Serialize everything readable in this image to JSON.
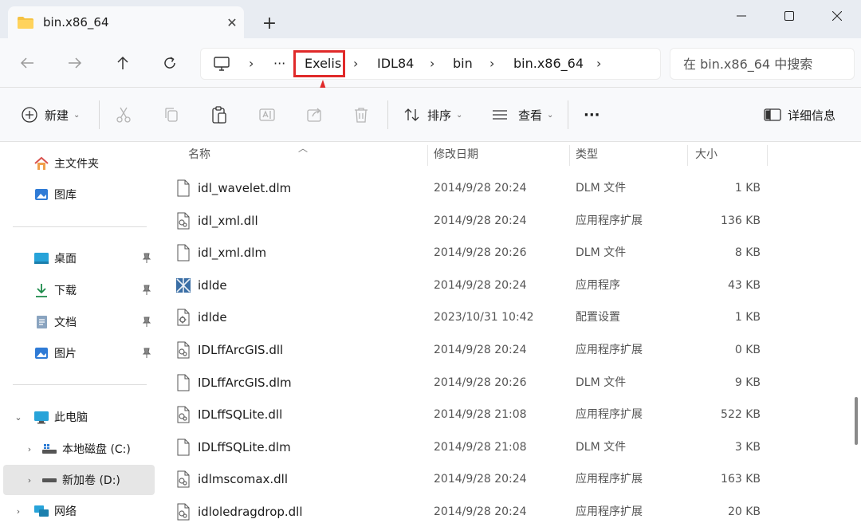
{
  "window": {
    "tab_title": "bin.x86_64",
    "new_tab": "+"
  },
  "breadcrumb": {
    "items": [
      "Exelis",
      "IDL84",
      "bin",
      "bin.x86_64"
    ],
    "overflow": "···",
    "separator": "›"
  },
  "search": {
    "placeholder": "在 bin.x86_64 中搜索"
  },
  "toolbar": {
    "new_label": "新建",
    "sort_label": "排序",
    "view_label": "查看",
    "more_label": "···",
    "details_label": "详细信息"
  },
  "sidebar": {
    "home": "主文件夹",
    "gallery": "图库",
    "desktop": "桌面",
    "downloads": "下载",
    "documents": "文档",
    "pictures": "图片",
    "this_pc": "此电脑",
    "drive_c": "本地磁盘 (C:)",
    "drive_d": "新加卷 (D:)",
    "network": "网络"
  },
  "columns": {
    "name": "名称",
    "date": "修改日期",
    "type": "类型",
    "size": "大小"
  },
  "files": [
    {
      "name": "idl_wavelet.dlm",
      "date": "2014/9/28 20:24",
      "type": "DLM 文件",
      "size": "1 KB",
      "icon": "blank-file-icon"
    },
    {
      "name": "idl_xml.dll",
      "date": "2014/9/28 20:24",
      "type": "应用程序扩展",
      "size": "136 KB",
      "icon": "dll-file-icon"
    },
    {
      "name": "idl_xml.dlm",
      "date": "2014/9/28 20:26",
      "type": "DLM 文件",
      "size": "8 KB",
      "icon": "blank-file-icon"
    },
    {
      "name": "idlde",
      "date": "2014/9/28 20:24",
      "type": "应用程序",
      "size": "43 KB",
      "icon": "app-icon"
    },
    {
      "name": "idlde",
      "date": "2023/10/31 10:42",
      "type": "配置设置",
      "size": "1 KB",
      "icon": "config-file-icon"
    },
    {
      "name": "IDLffArcGIS.dll",
      "date": "2014/9/28 20:24",
      "type": "应用程序扩展",
      "size": "0 KB",
      "icon": "dll-file-icon"
    },
    {
      "name": "IDLffArcGIS.dlm",
      "date": "2014/9/28 20:26",
      "type": "DLM 文件",
      "size": "9 KB",
      "icon": "blank-file-icon"
    },
    {
      "name": "IDLffSQLite.dll",
      "date": "2014/9/28 21:08",
      "type": "应用程序扩展",
      "size": "522 KB",
      "icon": "dll-file-icon"
    },
    {
      "name": "IDLffSQLite.dlm",
      "date": "2014/9/28 21:08",
      "type": "DLM 文件",
      "size": "3 KB",
      "icon": "blank-file-icon"
    },
    {
      "name": "idlmscomax.dll",
      "date": "2014/9/28 20:24",
      "type": "应用程序扩展",
      "size": "163 KB",
      "icon": "dll-file-icon"
    },
    {
      "name": "idloledragdrop.dll",
      "date": "2014/9/28 20:24",
      "type": "应用程序扩展",
      "size": "20 KB",
      "icon": "dll-file-icon"
    }
  ],
  "colors": {
    "highlight": "#e02a2a",
    "accent": "#0067c0"
  }
}
